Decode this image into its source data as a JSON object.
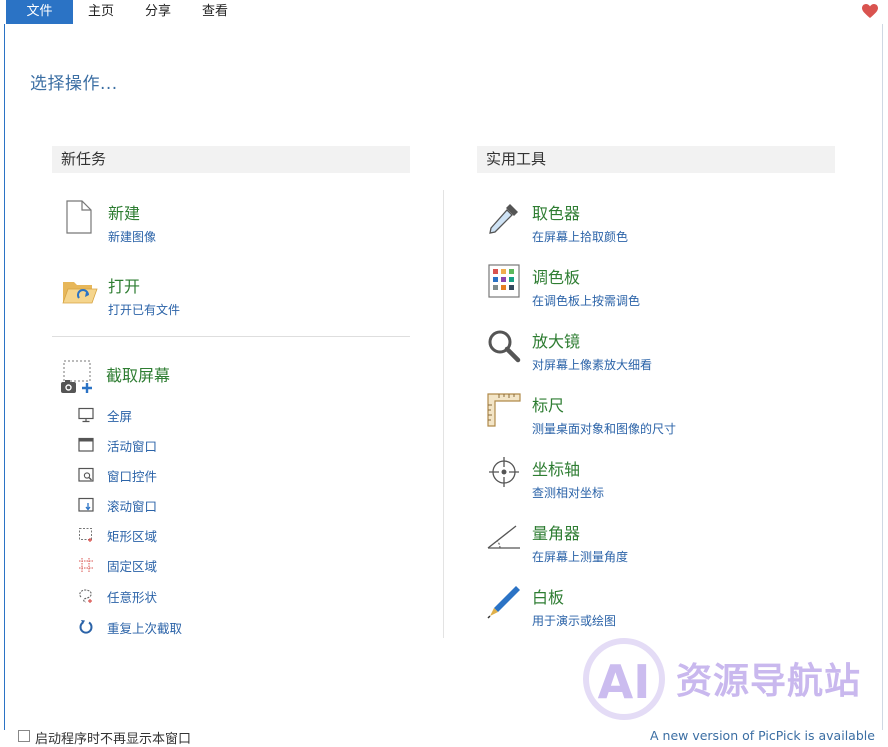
{
  "ribbon": {
    "tabs": [
      {
        "label": "文件",
        "active": true
      },
      {
        "label": "主页",
        "active": false
      },
      {
        "label": "分享",
        "active": false
      },
      {
        "label": "查看",
        "active": false
      }
    ],
    "heart_icon": "heart-icon"
  },
  "prompt": "选择操作...",
  "left": {
    "header": "新任务",
    "items": [
      {
        "title": "新建",
        "subtitle": "新建图像",
        "icon": "blank-document-icon"
      },
      {
        "title": "打开",
        "subtitle": "打开已有文件",
        "icon": "open-folder-icon"
      }
    ],
    "capture": {
      "title": "截取屏幕",
      "icon": "screen-capture-icon",
      "options": [
        {
          "label": "全屏",
          "icon": "monitor-icon"
        },
        {
          "label": "活动窗口",
          "icon": "window-icon"
        },
        {
          "label": "窗口控件",
          "icon": "window-control-icon"
        },
        {
          "label": "滚动窗口",
          "icon": "scroll-window-icon"
        },
        {
          "label": "矩形区域",
          "icon": "rectangle-region-icon"
        },
        {
          "label": "固定区域",
          "icon": "fixed-region-icon"
        },
        {
          "label": "任意形状",
          "icon": "freehand-shape-icon"
        },
        {
          "label": "重复上次截取",
          "icon": "repeat-icon"
        }
      ]
    }
  },
  "right": {
    "header": "实用工具",
    "items": [
      {
        "title": "取色器",
        "subtitle": "在屏幕上拾取颜色",
        "icon": "eyedropper-icon"
      },
      {
        "title": "调色板",
        "subtitle": "在调色板上按需调色",
        "icon": "palette-icon"
      },
      {
        "title": "放大镜",
        "subtitle": "对屏幕上像素放大细看",
        "icon": "magnifier-icon"
      },
      {
        "title": "标尺",
        "subtitle": "测量桌面对象和图像的尺寸",
        "icon": "ruler-icon"
      },
      {
        "title": "坐标轴",
        "subtitle": "查测相对坐标",
        "icon": "crosshair-icon"
      },
      {
        "title": "量角器",
        "subtitle": "在屏幕上测量角度",
        "icon": "protractor-icon"
      },
      {
        "title": "白板",
        "subtitle": "用于演示或绘图",
        "icon": "pen-icon"
      }
    ]
  },
  "footer": {
    "checkbox_label": "启动程序时不再显示本窗口",
    "update_notice": "A new version of PicPick is available"
  },
  "watermark": {
    "text": "资源导航站",
    "logo": "AI"
  },
  "colors": {
    "accent": "#2b73c5",
    "title_green": "#2e7d32",
    "link_blue": "#2b63a8"
  }
}
